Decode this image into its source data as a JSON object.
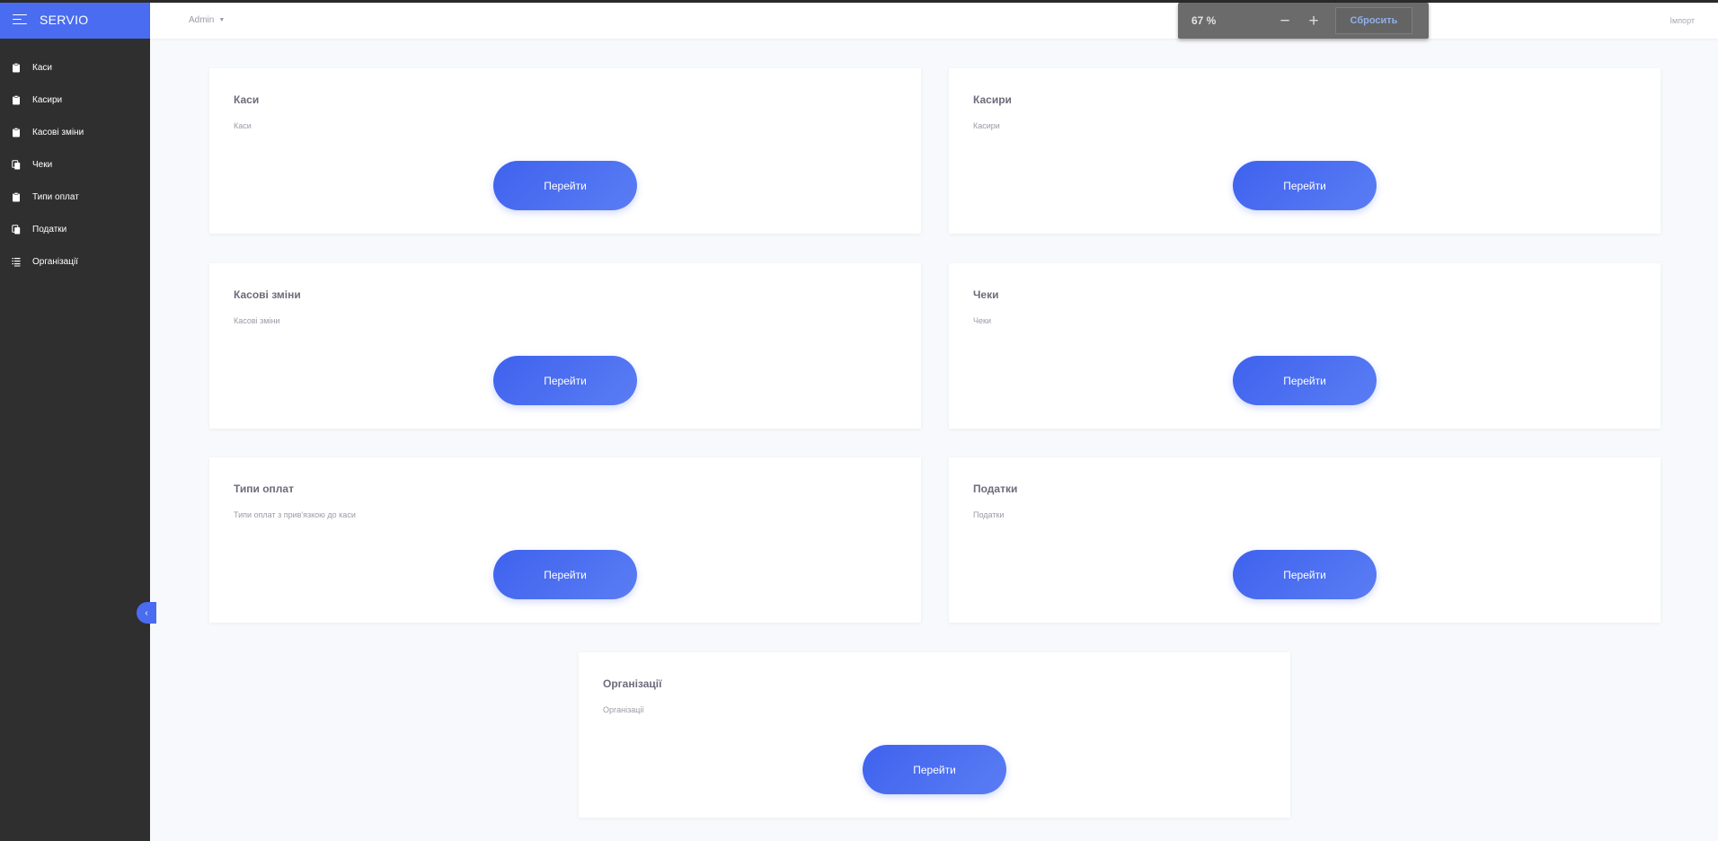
{
  "app": {
    "brand": "SERVIO"
  },
  "sidebar": {
    "items": [
      {
        "label": "Каси",
        "icon": "clipboard-icon"
      },
      {
        "label": "Касири",
        "icon": "clipboard-icon"
      },
      {
        "label": "Касові зміни",
        "icon": "clipboard-icon"
      },
      {
        "label": "Чеки",
        "icon": "copy-icon"
      },
      {
        "label": "Типи оплат",
        "icon": "clipboard-icon"
      },
      {
        "label": "Податки",
        "icon": "copy-icon"
      },
      {
        "label": "Організації",
        "icon": "list-icon"
      }
    ],
    "collapse_glyph": "‹"
  },
  "header": {
    "user": "Admin",
    "import_label": "Імпорт"
  },
  "zoom": {
    "value": "67 %",
    "minus": "−",
    "plus": "+",
    "reset_label": "Сбросить"
  },
  "cards": [
    {
      "title": "Каси",
      "subtitle": "Каси",
      "button": "Перейти"
    },
    {
      "title": "Касири",
      "subtitle": "Касири",
      "button": "Перейти"
    },
    {
      "title": "Касові зміни",
      "subtitle": "Касові зміни",
      "button": "Перейти"
    },
    {
      "title": "Чеки",
      "subtitle": "Чеки",
      "button": "Перейти"
    },
    {
      "title": "Типи оплат",
      "subtitle": "Типи оплат з прив'язкою до каси",
      "button": "Перейти"
    },
    {
      "title": "Податки",
      "subtitle": "Податки",
      "button": "Перейти"
    },
    {
      "title": "Організації",
      "subtitle": "Організації",
      "button": "Перейти"
    }
  ],
  "colors": {
    "accent": "#4a6cf0",
    "sidebar_bg": "#2f2f2f",
    "page_bg": "#f8f9fc"
  }
}
